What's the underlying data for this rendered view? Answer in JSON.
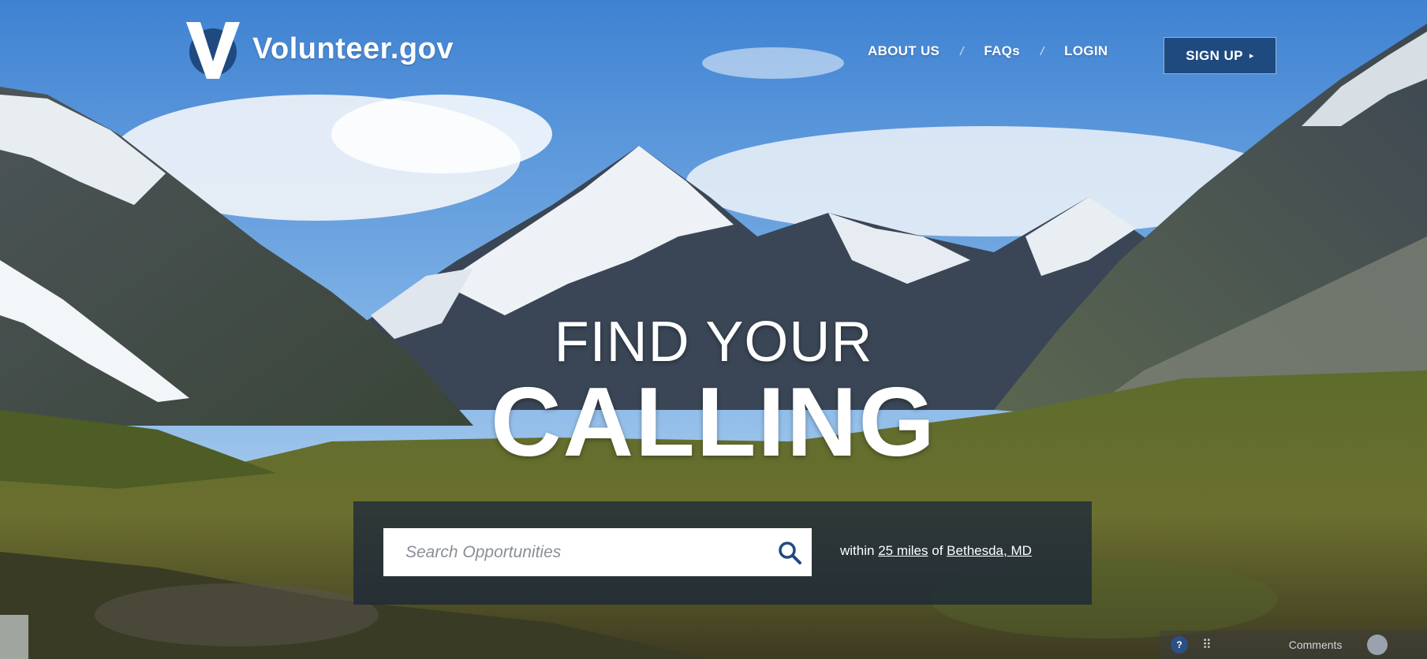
{
  "brand": {
    "name": "Volunteer.gov",
    "logo_letter": "V"
  },
  "nav": {
    "about": "ABOUT US",
    "faqs": "FAQs",
    "login": "LOGIN",
    "separator": "/",
    "signup": "SIGN UP",
    "signup_arrow": "▸"
  },
  "hero": {
    "line1": "FIND YOUR",
    "line2": "CALLING"
  },
  "search": {
    "placeholder": "Search Opportunities",
    "within_prefix": "within",
    "distance": "25 miles",
    "of": "of",
    "location": "Bethesda, MD"
  },
  "toolbar": {
    "help": "?",
    "comments": "Comments"
  },
  "colors": {
    "brand_blue": "#1f4a80",
    "panel_bg": "#16233a",
    "sky_top": "#3a7fcf",
    "grass": "#5a6b2a"
  },
  "icons": [
    "logo-v-icon",
    "search-icon",
    "help-icon",
    "grid-icon",
    "avatar-icon"
  ]
}
